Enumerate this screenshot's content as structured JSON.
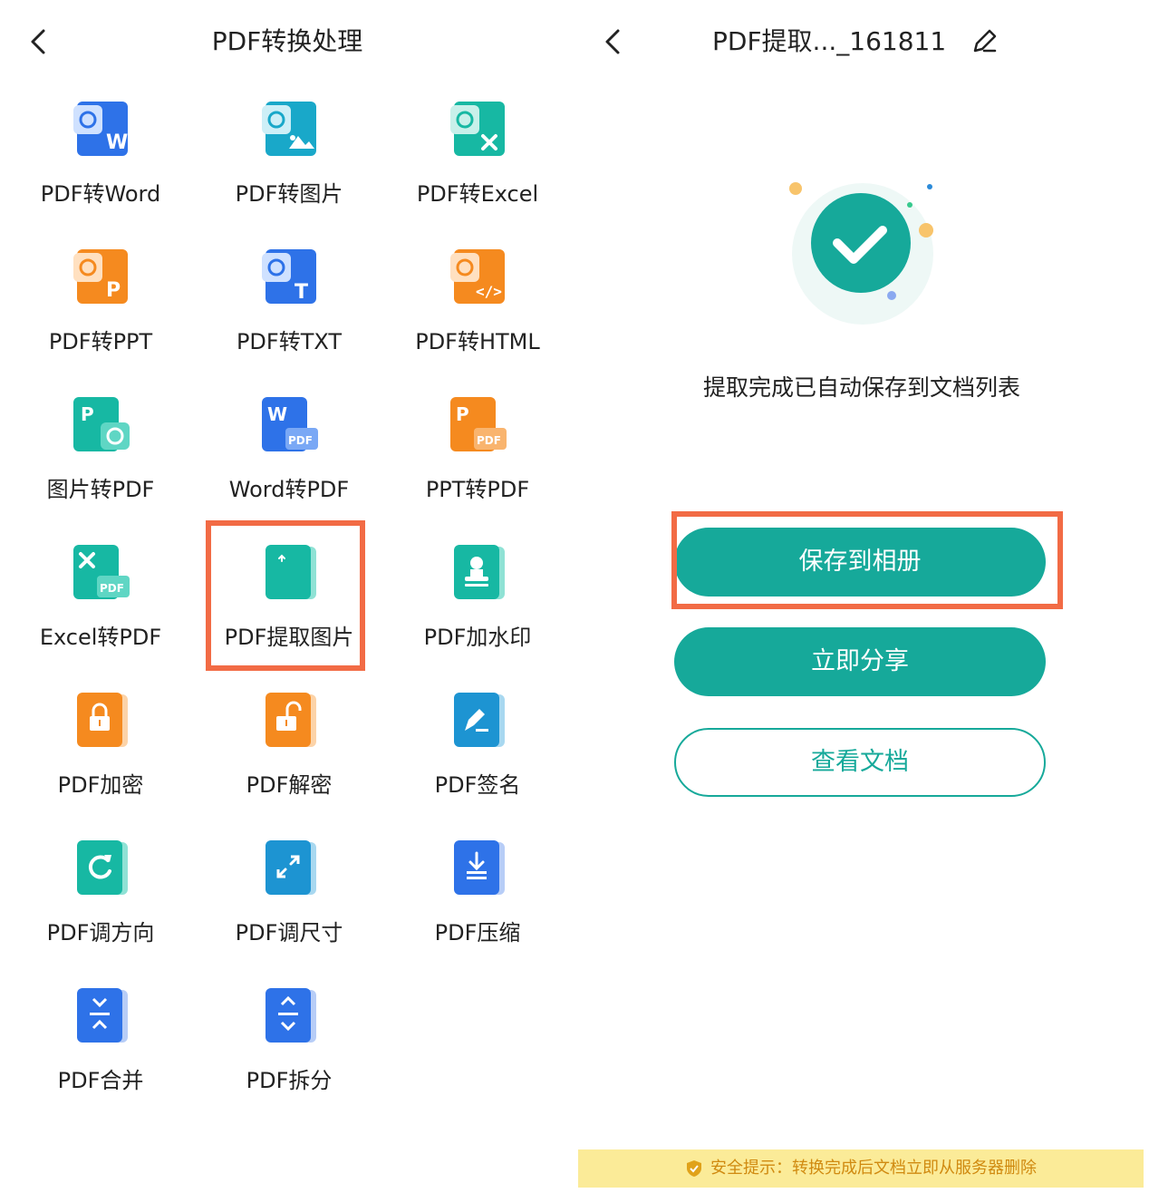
{
  "left": {
    "title": "PDF转换处理",
    "tools": [
      {
        "label": "PDF转Word",
        "icon": "pdf-to-word-icon"
      },
      {
        "label": "PDF转图片",
        "icon": "pdf-to-image-icon"
      },
      {
        "label": "PDF转Excel",
        "icon": "pdf-to-excel-icon"
      },
      {
        "label": "PDF转PPT",
        "icon": "pdf-to-ppt-icon"
      },
      {
        "label": "PDF转TXT",
        "icon": "pdf-to-txt-icon"
      },
      {
        "label": "PDF转HTML",
        "icon": "pdf-to-html-icon"
      },
      {
        "label": "图片转PDF",
        "icon": "image-to-pdf-icon"
      },
      {
        "label": "Word转PDF",
        "icon": "word-to-pdf-icon"
      },
      {
        "label": "PPT转PDF",
        "icon": "ppt-to-pdf-icon"
      },
      {
        "label": "Excel转PDF",
        "icon": "excel-to-pdf-icon"
      },
      {
        "label": "PDF提取图片",
        "icon": "extract-images-icon"
      },
      {
        "label": "PDF加水印",
        "icon": "watermark-icon"
      },
      {
        "label": "PDF加密",
        "icon": "lock-icon"
      },
      {
        "label": "PDF解密",
        "icon": "unlock-icon"
      },
      {
        "label": "PDF签名",
        "icon": "signature-pen-icon"
      },
      {
        "label": "PDF调方向",
        "icon": "rotate-icon"
      },
      {
        "label": "PDF调尺寸",
        "icon": "resize-icon"
      },
      {
        "label": "PDF压缩",
        "icon": "compress-icon"
      },
      {
        "label": "PDF合并",
        "icon": "merge-icon"
      },
      {
        "label": "PDF拆分",
        "icon": "split-icon"
      }
    ]
  },
  "right": {
    "title": "PDF提取..._161811",
    "message": "提取完成已自动保存到文档列表",
    "buttons": {
      "save_album": "保存到相册",
      "share": "立即分享",
      "view_doc": "查看文档"
    },
    "notice": "安全提示：转换完成后文档立即从服务器删除"
  },
  "colors": {
    "accent": "#16a99a",
    "highlight": "#f26b45",
    "notice_bg": "#fbeb98",
    "notice_text": "#d08a10"
  }
}
